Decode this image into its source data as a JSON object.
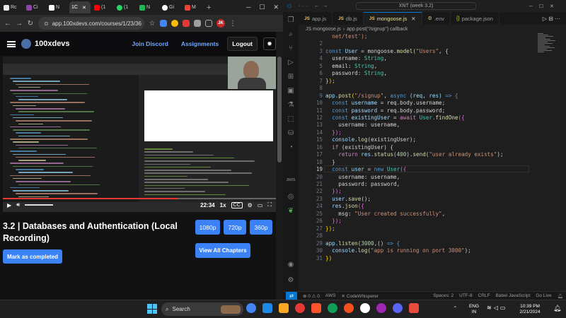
{
  "browser": {
    "tabs": [
      {
        "label": "Rc",
        "color": "#e8eaed"
      },
      {
        "label": "Ci",
        "color": "#8e44ad"
      },
      {
        "label": "N",
        "color": "#ffffff"
      },
      {
        "label": "1C",
        "color": "#3b3b3b",
        "active": true
      },
      {
        "label": "(1",
        "color": "#ff0000"
      },
      {
        "label": "(1",
        "color": "#25d366"
      },
      {
        "label": "N",
        "color": "#1db954"
      },
      {
        "label": "Gi",
        "color": "#ffffff"
      },
      {
        "label": "M",
        "color": "#ea4335"
      }
    ],
    "url": "app.100xdevs.com/courses/1/23/36",
    "profile": "JK"
  },
  "site": {
    "brand": "100xdevs",
    "nav": {
      "discord": "Join Discord",
      "assignments": "Assignments",
      "logout": "Logout"
    }
  },
  "video": {
    "time": "22:34",
    "speed": "1x",
    "cc": "CC",
    "progress_fraction": 0.64
  },
  "lesson": {
    "title": "3.2 | Databases and Authentication (Local Recording)",
    "quality": [
      "1080p",
      "720p",
      "360p"
    ],
    "mark": "Mark as completed",
    "chapters": "View All Chapters"
  },
  "vscode": {
    "title": "XNT (week 3.2)",
    "tabs": [
      {
        "file": "app.js"
      },
      {
        "file": "db.js"
      },
      {
        "file": "mongoose.js",
        "active": true
      },
      {
        "file": ".env"
      },
      {
        "file": "package.json"
      }
    ],
    "breadcrumb": [
      "JS mongoose.js",
      "app.post(\"/signup\") callback"
    ],
    "current_line": 19,
    "status": {
      "errors": "⊗ 0 ⚠ 0",
      "aws": "AWS",
      "cw": "CodeWhisperer",
      "spaces": "Spaces: 2",
      "enc": "UTF-8",
      "eol": "CRLF",
      "lang": "Babel JavaScript",
      "golive": "Go Live"
    }
  },
  "taskbar": {
    "search": "Search",
    "lang": "ENG",
    "region": "IN",
    "time": "10:39 PM",
    "date": "2/21/2024"
  }
}
